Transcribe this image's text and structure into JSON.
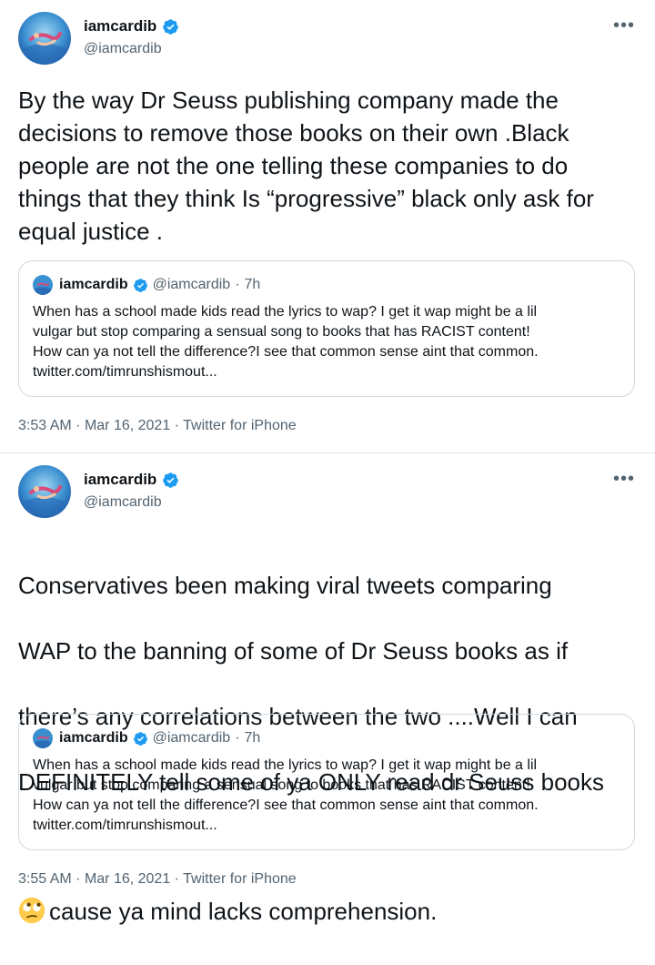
{
  "tweets": [
    {
      "author": {
        "name": "iamcardib",
        "handle": "@iamcardib"
      },
      "more_icon": "more-options-icon",
      "text": "By the way Dr Seuss publishing company made the\ndecisions to remove those books on their own .Black\npeople are not the one telling these companies to do\nthings that they think Is “progressive” black only ask for\nequal justice .",
      "quote": {
        "name": "iamcardib",
        "handle": "@iamcardib",
        "separator": "·",
        "time": "7h",
        "text": "When has a school made kids read the lyrics to wap? I get it wap might be a lil\nvulgar but stop comparing a sensual song to books that has RACIST content!\nHow can ya not tell the difference?I see that  common sense aint that common.\ntwitter.com/timrunshismout..."
      },
      "meta": {
        "time": "3:53 AM",
        "date": "Mar 16, 2021",
        "source": "Twitter for iPhone",
        "separator": "·"
      }
    },
    {
      "author": {
        "name": "iamcardib",
        "handle": "@iamcardib"
      },
      "more_icon": "more-options-icon",
      "text_lines": [
        "Conservatives been making viral tweets comparing",
        "WAP to the banning of some of Dr Seuss books as if",
        "there’s any correlations between the two ....Well I can",
        "DEFINITELY tell some of ya ONLY read dr Seuss books"
      ],
      "text_last": "cause ya mind lacks comprehension.",
      "emoji": "face-with-rolling-eyes",
      "quote": {
        "name": "iamcardib",
        "handle": "@iamcardib",
        "separator": "·",
        "time": "7h",
        "text": "When has a school made kids read the lyrics to wap? I get it wap might be a lil\nvulgar but stop comparing a sensual song to books that has RACIST content!\nHow can ya not tell the difference?I see that  common sense aint that common.\ntwitter.com/timrunshismout..."
      },
      "meta": {
        "time": "3:55 AM",
        "date": "Mar 16, 2021",
        "source": "Twitter for iPhone",
        "separator": "·"
      }
    }
  ],
  "colors": {
    "verified": "#1d9bf0",
    "text": "#0f1419",
    "secondary": "#536471",
    "border": "#cfd9de"
  }
}
